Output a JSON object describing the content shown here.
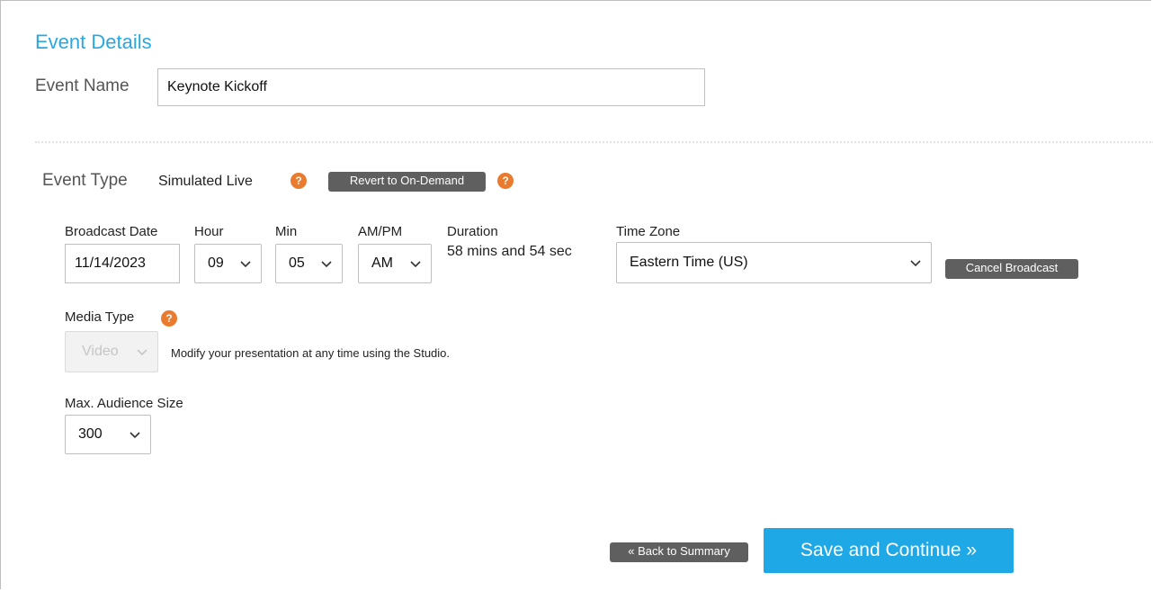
{
  "section": {
    "title": "Event Details"
  },
  "event_name": {
    "label": "Event Name",
    "value": "Keynote Kickoff"
  },
  "event_type": {
    "label": "Event Type",
    "value": "Simulated Live",
    "revert_button": "Revert to On-Demand",
    "help_icon": "?"
  },
  "broadcast": {
    "date_label": "Broadcast Date",
    "date_value": "11/14/2023",
    "hour_label": "Hour",
    "hour_value": "09",
    "min_label": "Min",
    "min_value": "05",
    "ampm_label": "AM/PM",
    "ampm_value": "AM",
    "duration_label": "Duration",
    "duration_value": "58 mins and 54 sec",
    "timezone_label": "Time Zone",
    "timezone_value": "Eastern Time (US)",
    "cancel_button": "Cancel Broadcast"
  },
  "media": {
    "label": "Media Type",
    "value": "Video",
    "hint": "Modify your presentation at any time using the Studio.",
    "help_icon": "?"
  },
  "audience": {
    "label": "Max. Audience Size",
    "value": "300"
  },
  "footer": {
    "back_button": "« Back to Summary",
    "save_button": "Save and Continue »"
  },
  "colors": {
    "accent": "#29a8e0",
    "primary_button": "#1fa8e6",
    "dark_button": "#5f5f5f",
    "help_icon": "#ea7a2e"
  },
  "icons": {
    "help": "question-circle-icon",
    "dropdown": "chevron-down-icon"
  }
}
